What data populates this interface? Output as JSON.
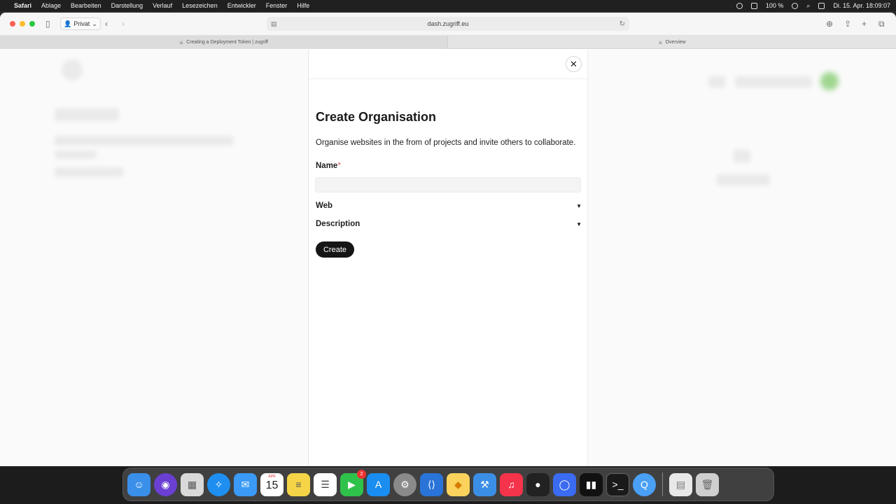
{
  "menubar": {
    "app": "Safari",
    "items": [
      "Ablage",
      "Bearbeiten",
      "Darstellung",
      "Verlauf",
      "Lesezeichen",
      "Entwickler",
      "Fenster",
      "Hilfe"
    ],
    "battery": "100 %",
    "datetime": "Di. 15. Apr. 18:09:07"
  },
  "toolbar": {
    "profile_label": "Privat",
    "url": "dash.zugriff.eu"
  },
  "tabs": [
    {
      "label": "Creating a Deployment Token | zugriff"
    },
    {
      "label": "Overview"
    }
  ],
  "panel": {
    "title": "Create Organisation",
    "description": "Organise websites in the from of projects and invite others to collaborate.",
    "name_label": "Name",
    "name_required_mark": "*",
    "name_value": "",
    "web_label": "Web",
    "description_label": "Description",
    "create_label": "Create"
  },
  "dock": {
    "calendar_month": "APR",
    "calendar_day": "15",
    "facetime_badge": "2"
  },
  "colors": {
    "accent_dark": "#151515",
    "required": "#e05a5a",
    "blur_green": "#9fd68f"
  }
}
